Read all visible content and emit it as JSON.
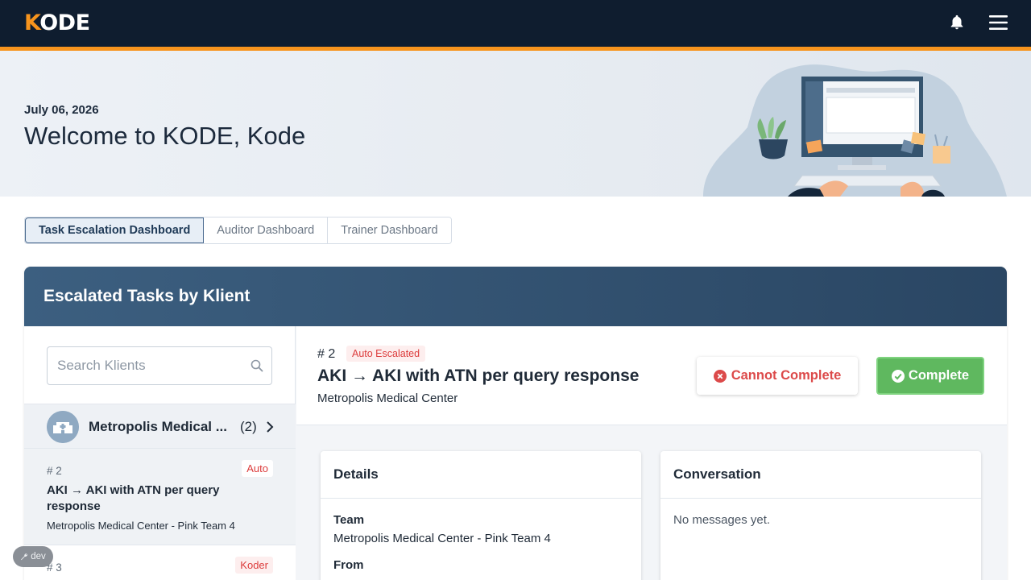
{
  "app": {
    "logo_k": "K",
    "logo_rest": "ODE"
  },
  "topbar": {
    "icons": [
      "bell-icon",
      "hamburger-menu-icon"
    ]
  },
  "colors": {
    "accent": "#f7941d",
    "navy": "#0f1d2f",
    "header_blue": "#2a4663",
    "complete_green": "#5fb85f",
    "alert_red": "#dc3c3c"
  },
  "hero": {
    "date": "July 06, 2026",
    "title": "Welcome to KODE, Kode"
  },
  "tabs": [
    {
      "label": "Task Escalation Dashboard",
      "active": true
    },
    {
      "label": "Auditor Dashboard",
      "active": false
    },
    {
      "label": "Trainer Dashboard",
      "active": false
    }
  ],
  "panel": {
    "title": "Escalated Tasks by Klient"
  },
  "search": {
    "placeholder": "Search Klients",
    "value": ""
  },
  "klient": {
    "name": "Metropolis Medical ...",
    "count": "(2)"
  },
  "tasks": [
    {
      "num": "# 2",
      "badge": "Auto",
      "title": "AKI → AKI with ATN per query response",
      "subtitle": "Metropolis Medical Center - Pink Team 4"
    },
    {
      "num": "# 3",
      "badge": "Koder"
    }
  ],
  "detail": {
    "num": "# 2",
    "badge": "Auto Escalated",
    "title": "AKI → AKI with ATN per query response",
    "subtitle": "Metropolis Medical Center",
    "cannot_label": "Cannot Complete",
    "complete_label": "Complete"
  },
  "details_card": {
    "title": "Details",
    "team_label": "Team",
    "team_value": "Metropolis Medical Center - Pink Team 4",
    "from_label": "From"
  },
  "conversation_card": {
    "title": "Conversation",
    "empty": "No messages yet."
  },
  "dev": {
    "label": "dev"
  }
}
